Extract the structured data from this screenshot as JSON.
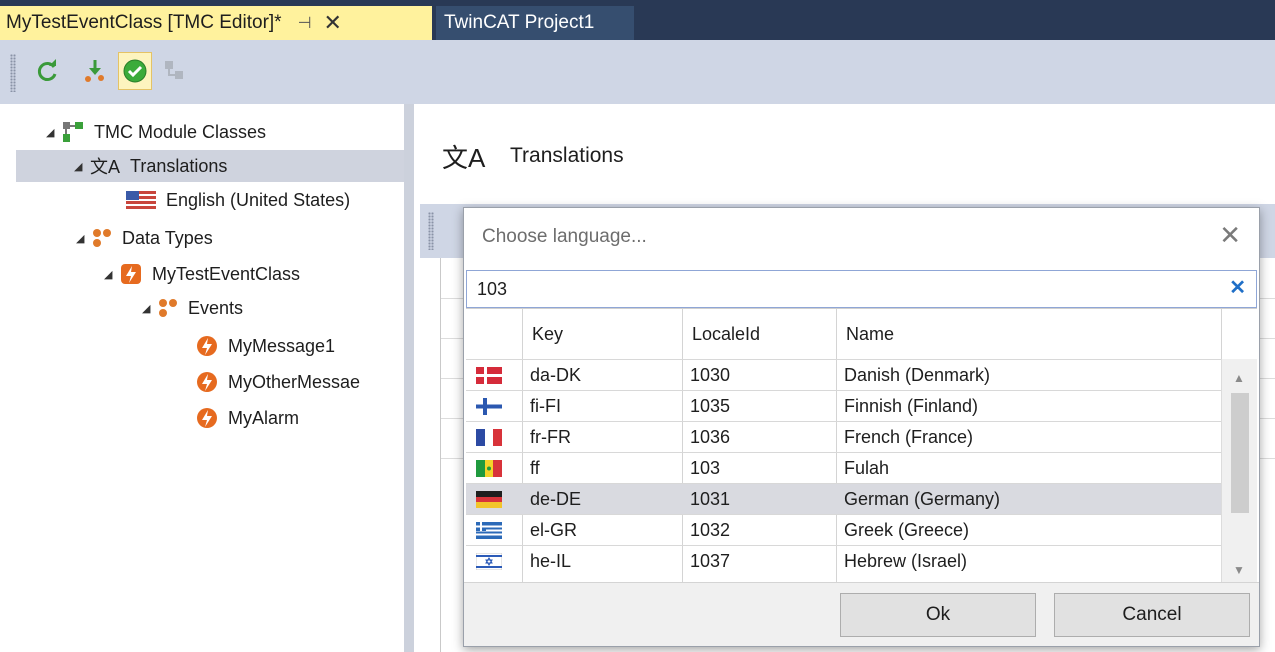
{
  "tabs": {
    "active_label": "MyTestEventClass [TMC Editor]*",
    "pin_glyph": "⊣",
    "close_glyph": "✕",
    "inactive_label": "TwinCAT Project1"
  },
  "toolbar": {
    "items": [
      "refresh-icon",
      "deploy-icon",
      "check-icon",
      "disabled-node-icon"
    ]
  },
  "tree": {
    "root": "TMC Module Classes",
    "translations": "Translations",
    "english": "English (United States)",
    "data_types": "Data Types",
    "class": "MyTestEventClass",
    "events": "Events",
    "message1": "MyMessage1",
    "other_message": "MyOtherMessae",
    "alarm": "MyAlarm"
  },
  "right": {
    "title": "Translations"
  },
  "dialog": {
    "title": "Choose language...",
    "close_glyph": "✕",
    "search_value": "103",
    "clear_glyph": "✕",
    "columns": {
      "key": "Key",
      "localeid": "LocaleId",
      "name": "Name"
    },
    "rows": [
      {
        "key": "da-DK",
        "localeid": "1030",
        "name": "Danish (Denmark)",
        "flag": "denmark-flag-icon"
      },
      {
        "key": "fi-FI",
        "localeid": "1035",
        "name": "Finnish (Finland)",
        "flag": "finland-flag-icon"
      },
      {
        "key": "fr-FR",
        "localeid": "1036",
        "name": "French (France)",
        "flag": "france-flag-icon"
      },
      {
        "key": "ff",
        "localeid": "103",
        "name": "Fulah",
        "flag": "senegal-flag-icon"
      },
      {
        "key": "de-DE",
        "localeid": "1031",
        "name": "German (Germany)",
        "flag": "germany-flag-icon",
        "selected": true
      },
      {
        "key": "el-GR",
        "localeid": "1032",
        "name": "Greek (Greece)",
        "flag": "greece-flag-icon"
      },
      {
        "key": "he-IL",
        "localeid": "1037",
        "name": "Hebrew (Israel)",
        "flag": "israel-flag-icon"
      }
    ],
    "ok_label": "Ok",
    "cancel_label": "Cancel"
  },
  "colors": {
    "tab_active_bg": "#fff29d",
    "tab_strip_bg": "#293955",
    "toolbar_bg": "#cfd6e5",
    "selection_bg": "#d9dae0",
    "accent_blue": "#1f6fc7"
  }
}
